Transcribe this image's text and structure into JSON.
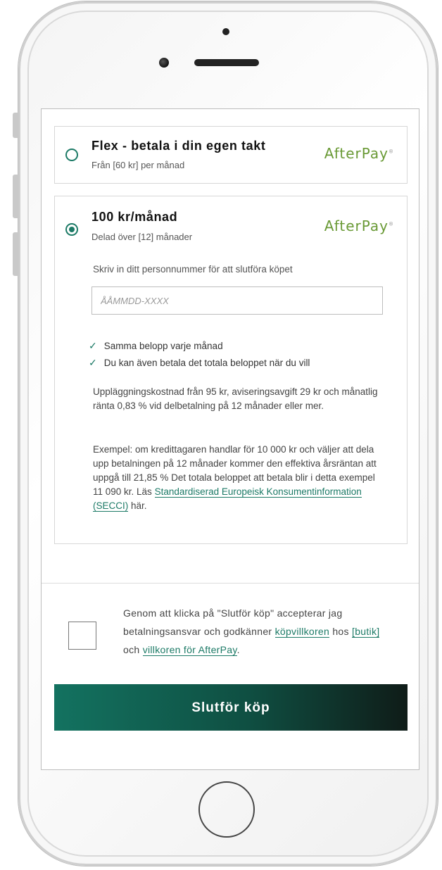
{
  "option1": {
    "title": "Flex - betala i din egen takt",
    "subtitle": "Från [60 kr] per månad",
    "brand": "AfterPay",
    "brand_mark": "®",
    "selected": false
  },
  "option2": {
    "title": "100 kr/månad",
    "subtitle": "Delad över [12] månader",
    "brand": "AfterPay",
    "brand_mark": "®",
    "selected": true,
    "ssn_label": "Skriv in ditt personnummer för att slutföra köpet",
    "ssn_placeholder": "ÅÅMMDD-XXXX",
    "benefits": [
      "Samma belopp varje månad",
      "Du kan även betala det totala beloppet när du vill"
    ],
    "fees_text": "Uppläggningskostnad från 95 kr, aviseringsavgift 29 kr och månatlig ränta 0,83 % vid delbetalning på 12 månader eller mer.",
    "example_text": "Exempel: om kredittagaren handlar för 10 000 kr och väljer att dela upp betalningen på 12 månader kommer den effektiva årsräntan att uppgå till 21,85 % Det totala beloppet att betala blir i detta exempel 11 090 kr. Läs",
    "example_link": "Standardiserad Europeisk Konsumentinformation (SECCI)",
    "example_suffix": "här."
  },
  "terms": {
    "text_before": "Genom att klicka på \"Slutför köp\" accepterar jag betalningsansvar och godkänner",
    "link1": "köpvillkoren",
    "text_mid1": "hos",
    "link2": "[butik]",
    "text_mid2": "och",
    "link3": "villkoren för AfterPay",
    "text_end": "."
  },
  "cta": {
    "label": "Slutför köp"
  },
  "icons": {
    "check": "✓",
    "radio_unchecked": "radio-empty",
    "radio_checked": "radio-filled"
  },
  "colors": {
    "accent": "#1c7a66",
    "brand": "#6a9a36",
    "cta_start": "#137260",
    "cta_end": "#0f1c18"
  }
}
